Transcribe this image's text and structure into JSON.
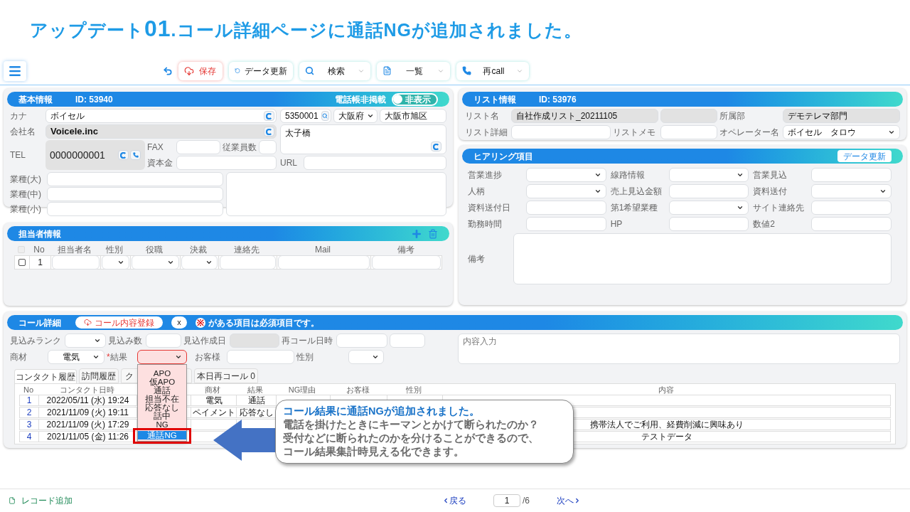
{
  "slide_title": {
    "prefix": "アップデート",
    "number": "01",
    "suffix": ".コール詳細ページに通話NGが追加されました。"
  },
  "toolbar": {
    "buttons": [
      {
        "kind": "save",
        "label": "保存"
      },
      {
        "kind": "refresh",
        "label": "データ更新"
      },
      {
        "kind": "search",
        "label": "検索"
      },
      {
        "kind": "list",
        "label": "一覧"
      },
      {
        "kind": "recall",
        "label": "再call"
      }
    ]
  },
  "basic_info": {
    "title": "基本情報",
    "id": "ID: 53940",
    "toggle_caption": "電話帳非掲載",
    "toggle": {
      "label": "非表示",
      "on": false
    },
    "kana": {
      "label": "カナ",
      "value": "ボイセル"
    },
    "postal": "5350001",
    "prefecture": "大阪府",
    "city": "大阪市旭区",
    "company": {
      "label": "会社名",
      "value": "Voicele.inc"
    },
    "address": "太子橋",
    "tel": {
      "label": "TEL",
      "value": "0000000001"
    },
    "fax_label": "FAX",
    "employees_label": "従業員数",
    "capital_label": "資本金",
    "url_label": "URL",
    "industry_labels": [
      "業種(大)",
      "業種(中)",
      "業種(小)"
    ]
  },
  "contacts": {
    "title": "担当者情報",
    "select_all_checked": false,
    "columns": [
      "No",
      "担当者名",
      "性別",
      "役職",
      "決裁",
      "連絡先",
      "Mail",
      "備考"
    ],
    "rows": [
      {
        "no": "1",
        "checked": false
      }
    ]
  },
  "list_info": {
    "title": "リスト情報",
    "id": "ID: 53976",
    "list_name": {
      "label": "リスト名",
      "value": "自社作成リスト_20211105"
    },
    "department": {
      "label": "所属部",
      "value": "デモテレマ部門"
    },
    "list_detail_label": "リスト詳細",
    "list_memo_label": "リストメモ",
    "operator": {
      "label": "オペレーター名",
      "value": "ボイセル　タロウ"
    }
  },
  "hearing": {
    "title": "ヒアリング項目",
    "update_button": "データ更新",
    "fields": [
      {
        "label": "営業進捗",
        "kind": "select"
      },
      {
        "label": "線路情報",
        "kind": "select"
      },
      {
        "label": "営業見込",
        "kind": "input"
      },
      {
        "label": "人柄",
        "kind": "select"
      },
      {
        "label": "売上見込金額",
        "kind": "input"
      },
      {
        "label": "資料送付",
        "kind": "select"
      },
      {
        "label": "資料送付日",
        "kind": "input"
      },
      {
        "label": "第1希望業種",
        "kind": "select"
      },
      {
        "label": "サイト連絡先",
        "kind": "input"
      },
      {
        "label": "勤務時間",
        "kind": "input"
      },
      {
        "label": "HP",
        "kind": "input"
      },
      {
        "label": "数値2",
        "kind": "input"
      }
    ],
    "remarks_label": "備考"
  },
  "call_detail": {
    "title": "コール詳細",
    "register_button": "コール内容登録",
    "close_button": "x",
    "required_mark": "※",
    "required_note": "がある項目は必須項目です。",
    "prospect_rank_label": "見込みランク",
    "prospect_count_label": "見込み数",
    "prospect_date_label": "見込作成日",
    "recall_label": "再コール日時",
    "product": {
      "label": "商材",
      "value": "電気"
    },
    "result": {
      "label": "結果",
      "required_mark": "*",
      "open": true
    },
    "customer_label": "お客様",
    "gender_label": "性別",
    "content_placeholder": "内容入力",
    "result_options": [
      {
        "label": "APO",
        "selected": false
      },
      {
        "label": "仮APO",
        "selected": false
      },
      {
        "label": "通話",
        "selected": false
      },
      {
        "label": "担当不在",
        "selected": false
      },
      {
        "label": "応答なし",
        "selected": false
      },
      {
        "label": "話中",
        "selected": false
      },
      {
        "label": "NG",
        "selected": false
      },
      {
        "label": "通話NG",
        "selected": true
      }
    ],
    "tabs": [
      {
        "label": "コンタクト履歴",
        "selected": true
      },
      {
        "label": "訪問履歴",
        "selected": false
      },
      {
        "label": "ク",
        "selected": false
      },
      {
        "label": "本日再コール 0",
        "selected": false
      }
    ],
    "table": {
      "headers": {
        "no": "No",
        "datetime": "コンタクト日時",
        "product": "商材",
        "result": "結果",
        "ng_reason": "NG理由",
        "customer": "お客様",
        "gender": "性別",
        "content": "内容"
      },
      "rows": [
        {
          "no": "1",
          "datetime": "2022/05/11 (水) 19:24",
          "product": "電気",
          "result": "通話"
        },
        {
          "no": "2",
          "datetime": "2021/11/09 (火) 19:11",
          "product": "ペイメント",
          "result": "応答なし"
        },
        {
          "no": "3",
          "datetime": "2021/11/09 (火) 17:29",
          "content": "携帯法人でご利用、経費削減に興味あり"
        },
        {
          "no": "4",
          "datetime": "2021/11/05 (金) 11:26",
          "content": "テストデータ"
        }
      ]
    }
  },
  "callout": {
    "title": "コール結果に通話NGが追加されました。",
    "lines": [
      "電話を掛けたときにキーマンとかけて断られたのか？",
      "受付などに断られたのかを分けることができるので、",
      "コール結果集計時見える化できます。"
    ]
  },
  "footer": {
    "add_record": "レコード追加",
    "prev": "戻る",
    "page": "1",
    "total": "/6",
    "next": "次へ"
  }
}
